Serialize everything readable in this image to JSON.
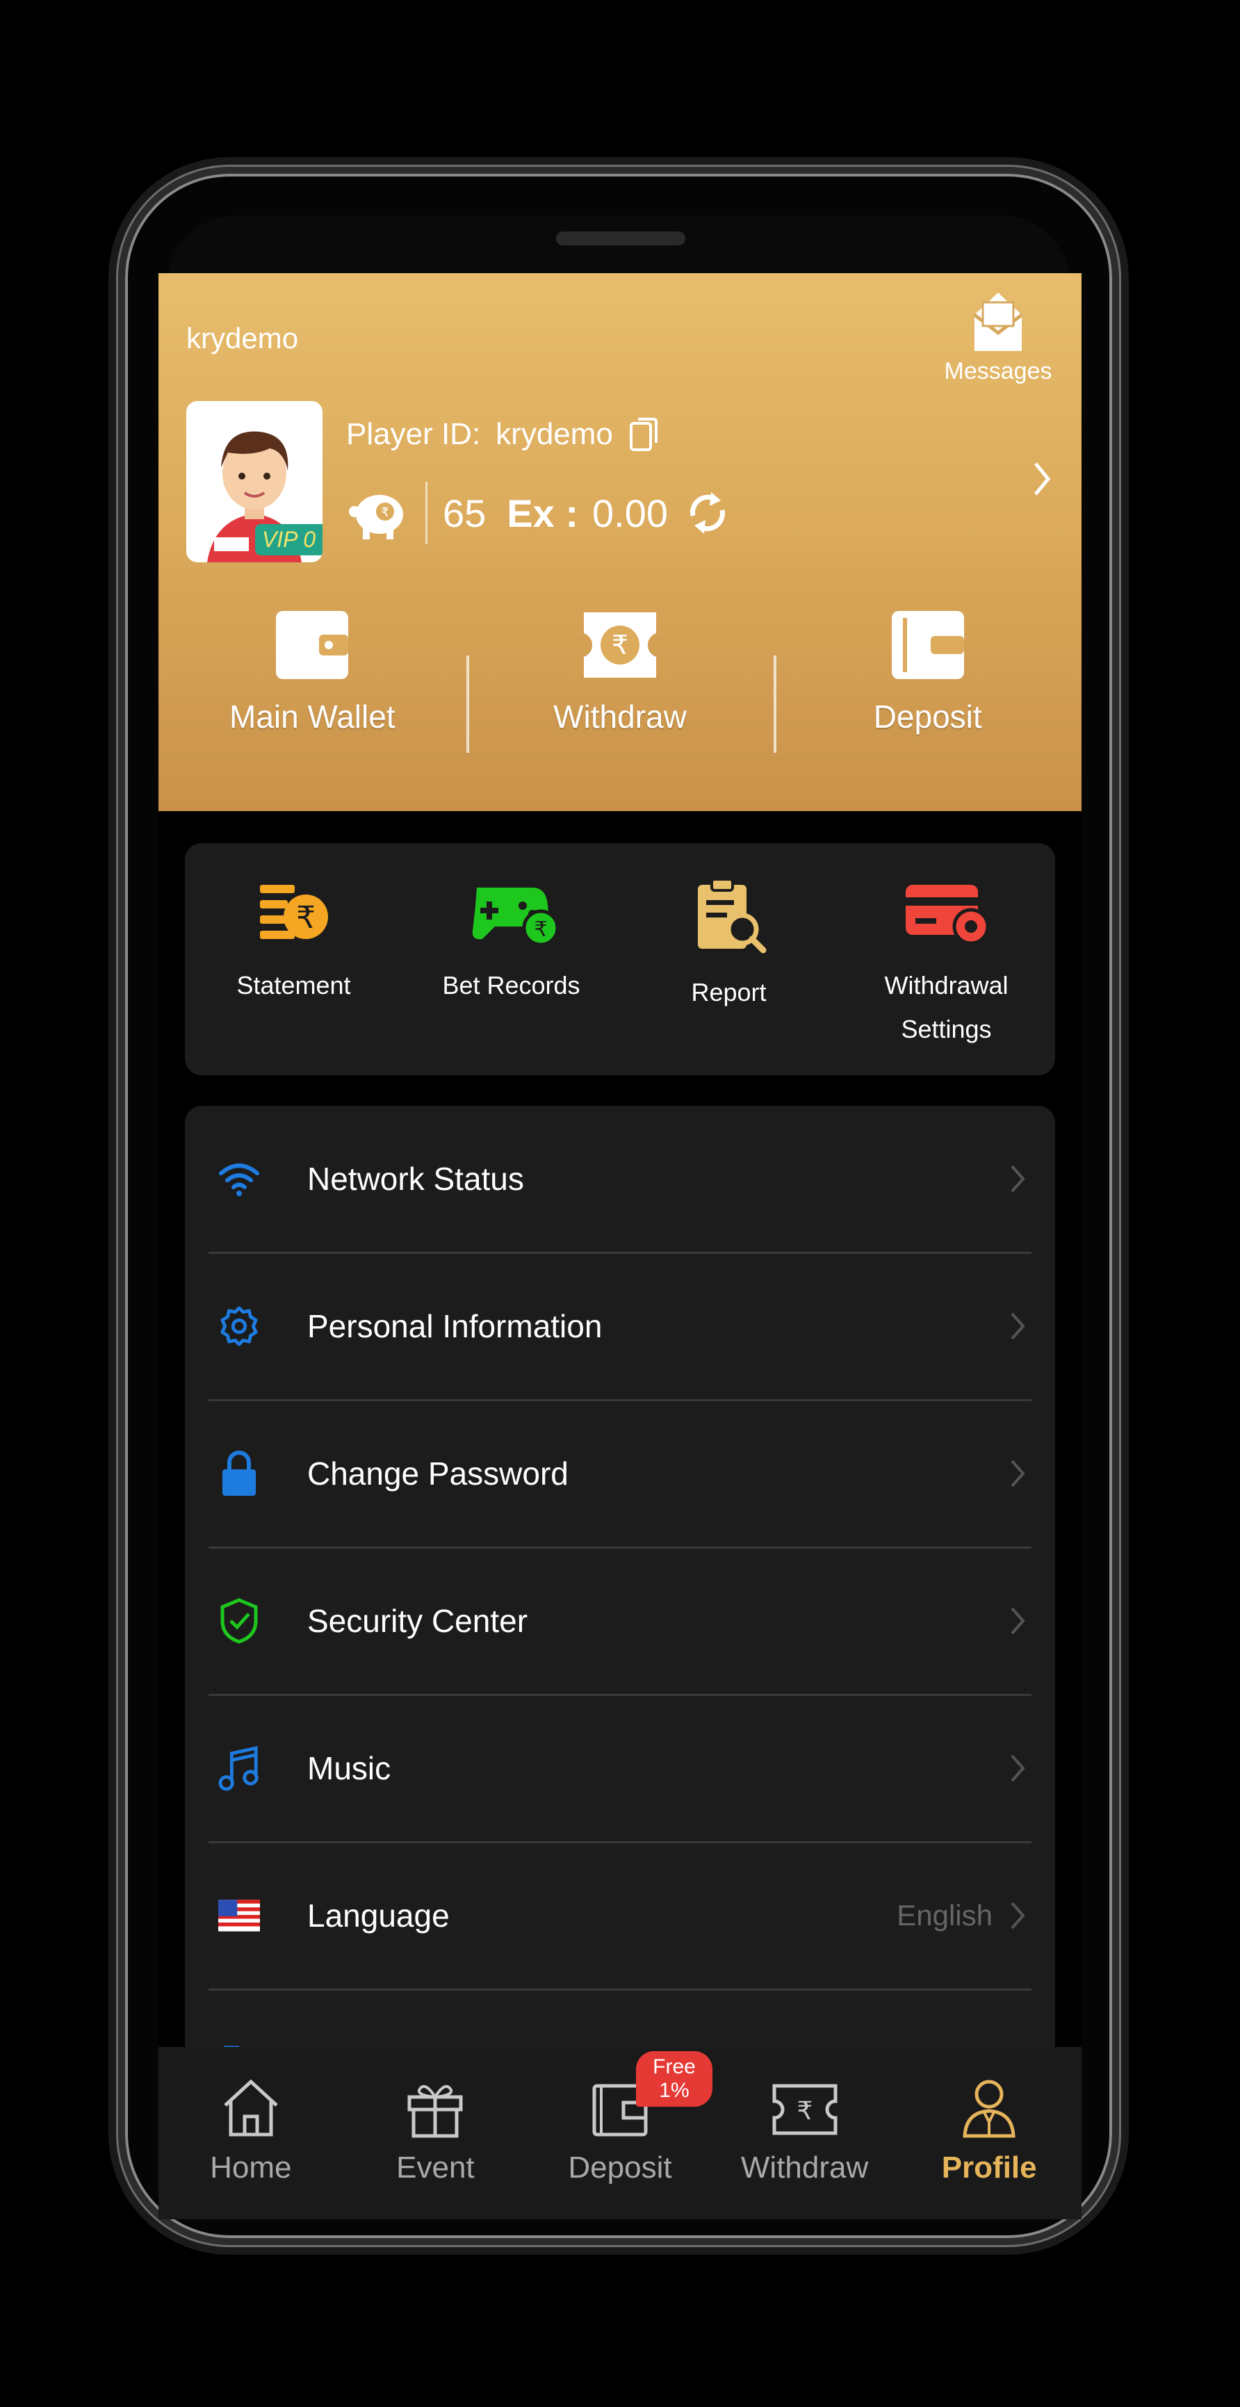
{
  "header": {
    "username": "krydemo",
    "messages_label": "Messages",
    "player_id_label": "Player ID:",
    "player_id_value": "krydemo",
    "vip_badge": "VIP 0",
    "points": "65",
    "ex_label": "Ex :",
    "ex_value": "0.00",
    "wallet_actions": [
      {
        "label": "Main Wallet",
        "icon": "wallet-icon"
      },
      {
        "label": "Withdraw",
        "icon": "rupee-ticket-icon"
      },
      {
        "label": "Deposit",
        "icon": "deposit-icon"
      }
    ]
  },
  "quick_actions": [
    {
      "label": "Statement",
      "icon": "statement-coin-icon",
      "color": "#f5a623"
    },
    {
      "label": "Bet Records",
      "icon": "gamepad-icon",
      "color": "#1ec71e"
    },
    {
      "label": "Report",
      "icon": "clipboard-search-icon",
      "color": "#e9c06b"
    },
    {
      "label": "Withdrawal\nSettings",
      "icon": "card-gear-icon",
      "color": "#f0453a"
    }
  ],
  "menu": [
    {
      "label": "Network Status",
      "icon": "wifi-icon",
      "value": ""
    },
    {
      "label": "Personal Information",
      "icon": "gear-icon",
      "value": ""
    },
    {
      "label": "Change Password",
      "icon": "lock-icon",
      "value": ""
    },
    {
      "label": "Security Center",
      "icon": "shield-check-icon",
      "value": ""
    },
    {
      "label": "Music",
      "icon": "music-note-icon",
      "value": ""
    },
    {
      "label": "Language",
      "icon": "flag-icon",
      "value": "English"
    }
  ],
  "bottom_nav": [
    {
      "label": "Home",
      "icon": "home-icon",
      "active": false
    },
    {
      "label": "Event",
      "icon": "gift-icon",
      "active": false
    },
    {
      "label": "Deposit",
      "icon": "wallet-icon",
      "active": false,
      "badge": "Free 1%"
    },
    {
      "label": "Withdraw",
      "icon": "rupee-ticket-icon",
      "active": false
    },
    {
      "label": "Profile",
      "icon": "user-icon",
      "active": true
    }
  ],
  "colors": {
    "gold_top": "#e7bd6d",
    "gold_bottom": "#c9924a",
    "card_bg": "#1c1c1c",
    "active_nav": "#e6b45a",
    "accent_blue": "#1e7be0",
    "accent_green": "#1ec71e"
  }
}
